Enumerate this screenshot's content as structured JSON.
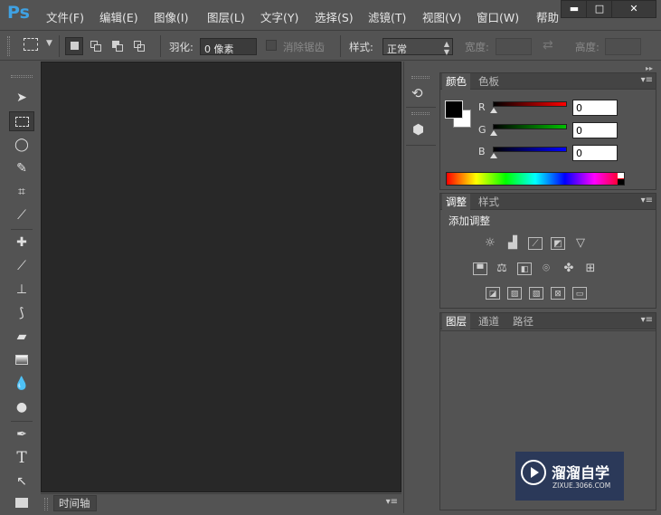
{
  "app": {
    "logo": "Ps"
  },
  "menu": [
    "文件(F)",
    "编辑(E)",
    "图像(I)",
    "图层(L)",
    "文字(Y)",
    "选择(S)",
    "滤镜(T)",
    "视图(V)",
    "窗口(W)",
    "帮助"
  ],
  "window_controls": {
    "minimize": "▬",
    "maximize": "□",
    "close": "✕"
  },
  "options": {
    "feather_label": "羽化:",
    "feather_value": "0 像素",
    "antialias_label": "消除锯齿",
    "style_label": "样式:",
    "style_value": "正常",
    "width_label": "宽度:",
    "height_label": "高度:"
  },
  "timeline": {
    "label": "时间轴"
  },
  "color_panel": {
    "tabs": [
      "颜色",
      "色板"
    ],
    "channels": [
      {
        "label": "R",
        "value": "0",
        "color": "#ff0000"
      },
      {
        "label": "G",
        "value": "0",
        "color": "#00c000"
      },
      {
        "label": "B",
        "value": "0",
        "color": "#0000ff"
      }
    ]
  },
  "adjust_panel": {
    "tabs": [
      "调整",
      "样式"
    ],
    "title": "添加调整"
  },
  "layers_panel": {
    "tabs": [
      "图层",
      "通道",
      "路径"
    ]
  },
  "watermark": {
    "text": "溜溜自学",
    "url": "ZIXUE.3066.COM"
  }
}
